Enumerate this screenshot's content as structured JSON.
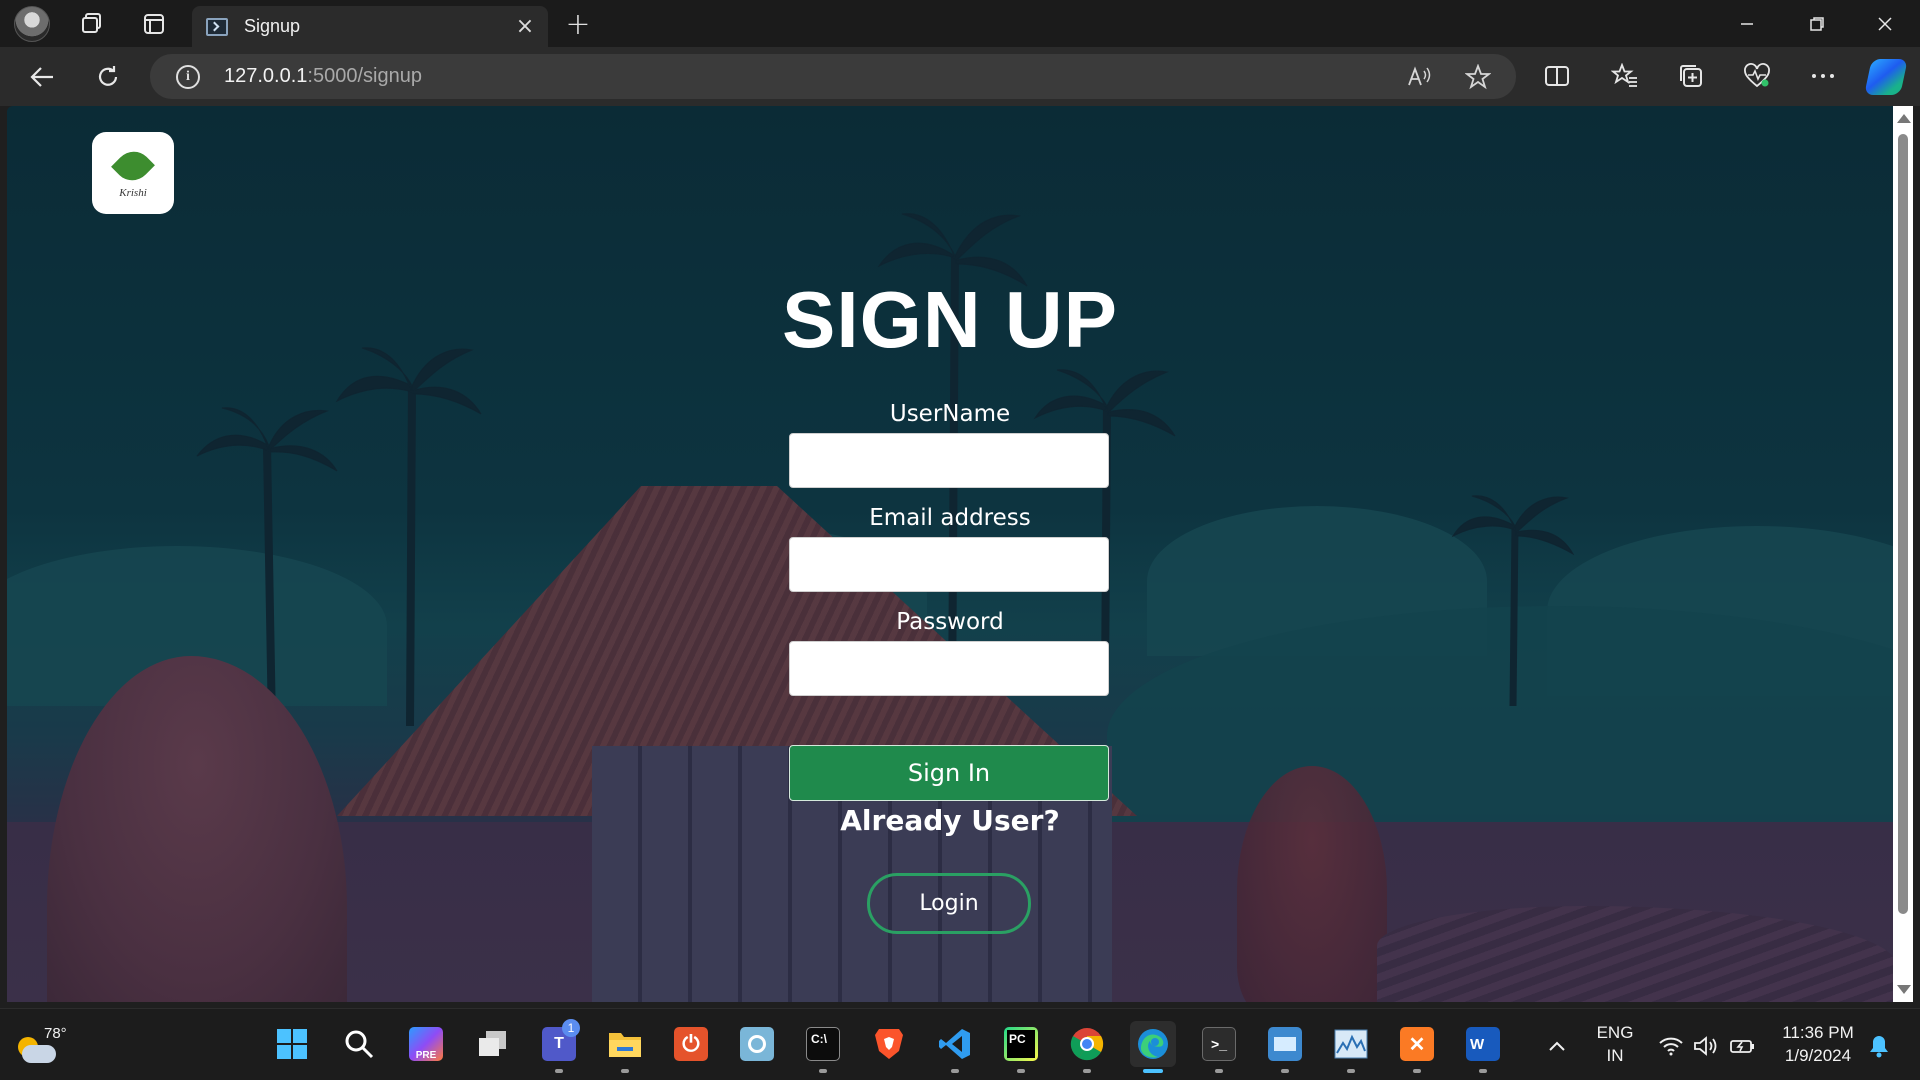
{
  "browser": {
    "tab_title": "Signup",
    "url_host": "127.0.0.1",
    "url_path": ":5000/signup",
    "tab_close_glyph": "×",
    "new_tab_glyph": "+"
  },
  "page": {
    "logo_text": "Krishi",
    "title": "SIGN UP",
    "fields": [
      {
        "label": "UserName",
        "value": ""
      },
      {
        "label": "Email address",
        "value": ""
      },
      {
        "label": "Password",
        "value": ""
      }
    ],
    "signin_label": "Sign In",
    "already_user_text": "Already User?",
    "login_label": "Login",
    "colors": {
      "signin_bg": "#1f8a4c",
      "login_border": "#2aa063",
      "background": "#0d3440"
    }
  },
  "taskbar": {
    "weather_temp": "78°",
    "teams_badge": "1",
    "lang_line1": "ENG",
    "lang_line2": "IN",
    "time": "11:36 PM",
    "date": "1/9/2024",
    "apps": [
      "start-icon",
      "search-icon",
      "copilot-pre-icon",
      "task-view-icon",
      "teams-icon",
      "file-explorer-icon",
      "power-icon",
      "photos-icon",
      "terminal-icon",
      "brave-icon",
      "vscode-icon",
      "pycharm-icon",
      "chrome-icon",
      "edge-icon",
      "powershell-icon",
      "control-panel-icon",
      "resource-monitor-icon",
      "xampp-icon",
      "word-icon"
    ]
  }
}
